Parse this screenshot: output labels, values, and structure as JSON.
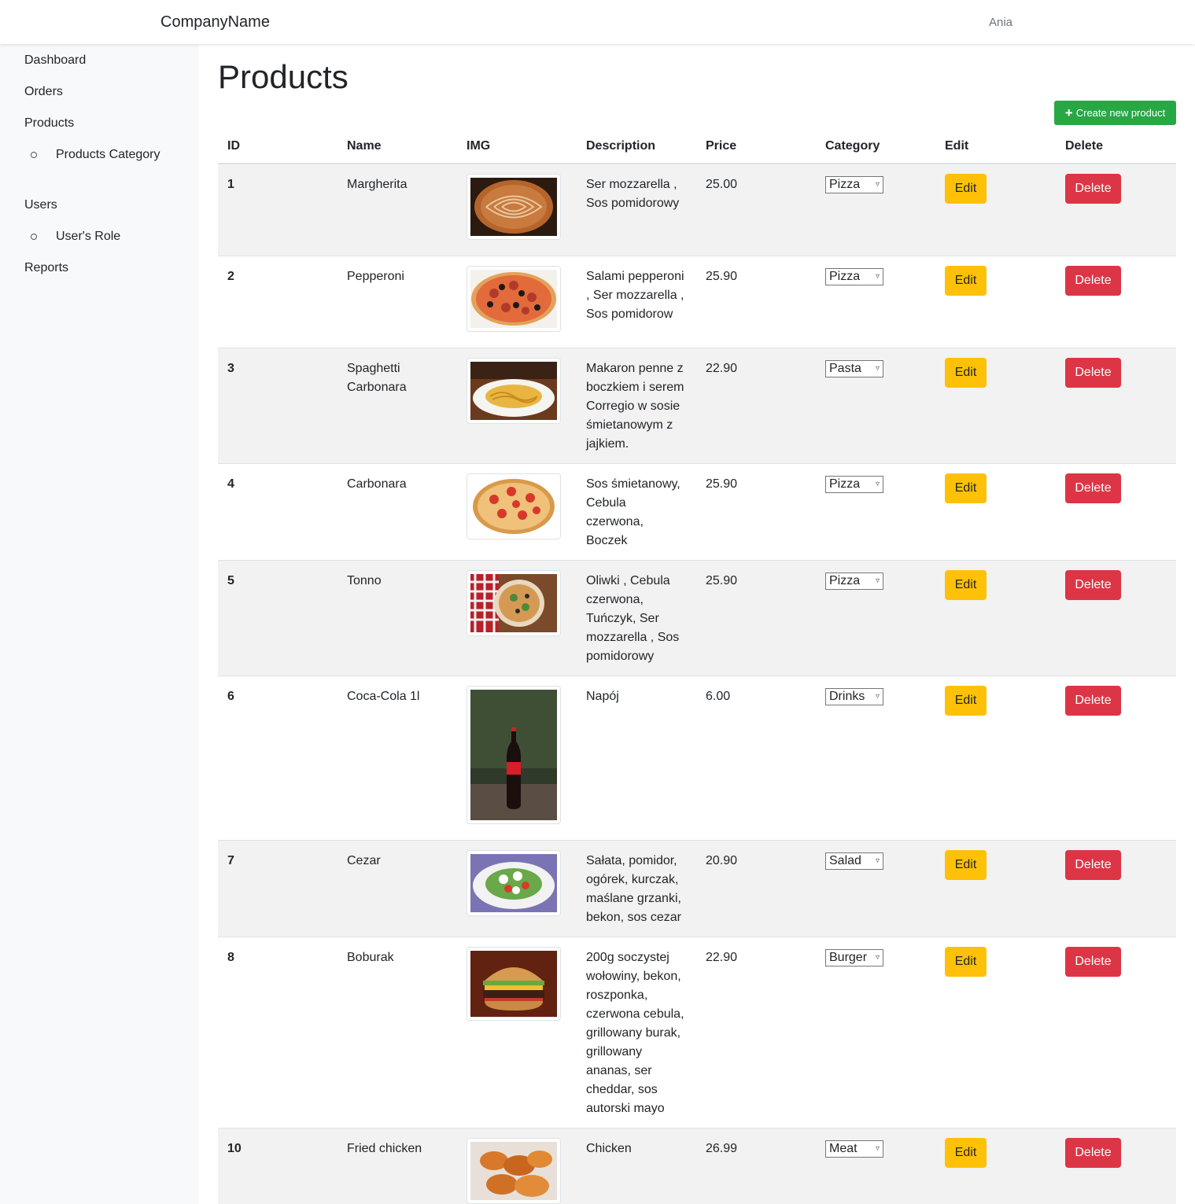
{
  "header": {
    "brand": "CompanyName",
    "user": "Ania"
  },
  "sidebar": {
    "items": [
      {
        "label": "Dashboard"
      },
      {
        "label": "Orders"
      },
      {
        "label": "Products"
      },
      {
        "label": "Products Category"
      },
      {
        "label": "Users"
      },
      {
        "label": "User's Role"
      },
      {
        "label": "Reports"
      }
    ]
  },
  "main": {
    "title": "Products",
    "create_label": "Create new product",
    "columns": [
      "ID",
      "Name",
      "IMG",
      "Description",
      "Price",
      "Category",
      "Edit",
      "Delete"
    ],
    "edit_label": "Edit",
    "delete_label": "Delete",
    "rows": [
      {
        "id": "1",
        "name": "Margherita",
        "description": "Ser mozzarella , Sos pomidorowy",
        "price": "25.00",
        "category": "Pizza",
        "image": "pizza-margherita"
      },
      {
        "id": "2",
        "name": "Pepperoni",
        "description": "Salami pepperoni , Ser mozzarella , Sos pomidorow",
        "price": "25.90",
        "category": "Pizza",
        "image": "pizza-pepperoni"
      },
      {
        "id": "3",
        "name": "Spaghetti Carbonara",
        "description": "Makaron penne z boczkiem i serem Corregio w sosie śmietanowym z jajkiem.",
        "price": "22.90",
        "category": "Pasta",
        "image": "pasta"
      },
      {
        "id": "4",
        "name": "Carbonara",
        "description": "Sos śmietanowy, Cebula czerwona, Boczek",
        "price": "25.90",
        "category": "Pizza",
        "image": "pizza-carbonara"
      },
      {
        "id": "5",
        "name": "Tonno",
        "description": "Oliwki , Cebula czerwona, Tuńczyk, Ser mozzarella , Sos pomidorowy",
        "price": "25.90",
        "category": "Pizza",
        "image": "pizza-tonno"
      },
      {
        "id": "6",
        "name": "Coca-Cola 1l",
        "description": "Napój",
        "price": "6.00",
        "category": "Drinks",
        "image": "cola-bottle"
      },
      {
        "id": "7",
        "name": "Cezar",
        "description": "Sałata, pomidor, ogórek, kurczak, maślane grzanki, bekon, sos cezar",
        "price": "20.90",
        "category": "Salad",
        "image": "salad"
      },
      {
        "id": "8",
        "name": "Boburak",
        "description": "200g soczystej wołowiny, bekon, roszponka, czerwona cebula, grillowany burak, grillowany ananas, ser cheddar, sos autorski mayo",
        "price": "22.90",
        "category": "Burger",
        "image": "burger"
      },
      {
        "id": "10",
        "name": "Fried chicken",
        "description": "Chicken",
        "price": "26.99",
        "category": "Meat",
        "image": "fried-chicken"
      }
    ]
  },
  "colors": {
    "create": "#28a745",
    "edit": "#ffc107",
    "delete": "#dc3545"
  }
}
